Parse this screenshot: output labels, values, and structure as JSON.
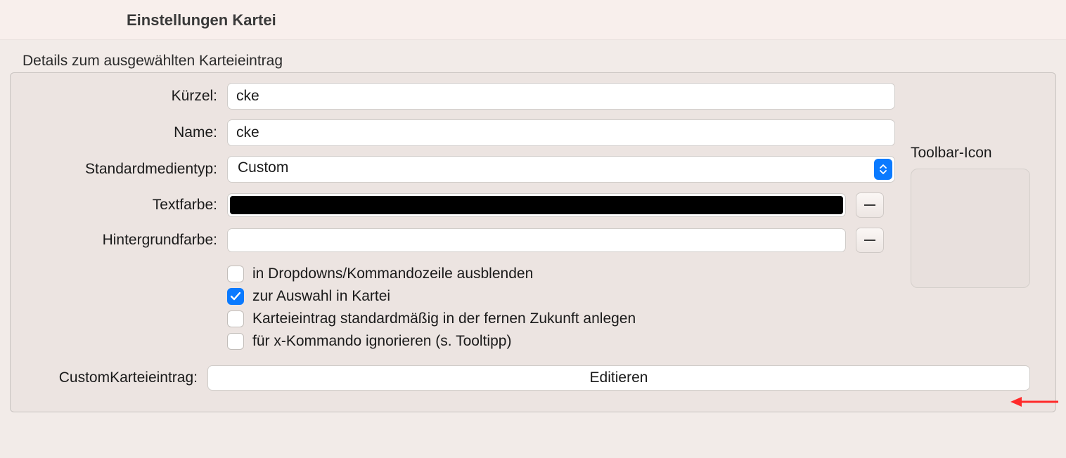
{
  "header": {
    "title": "Einstellungen Kartei"
  },
  "panel": {
    "legend": "Details zum ausgewählten Karteieintrag",
    "fields": {
      "kuerzel": {
        "label": "Kürzel:",
        "value": "cke"
      },
      "name": {
        "label": "Name:",
        "value": "cke"
      },
      "medientyp": {
        "label": "Standardmedientyp:",
        "selected": "Custom"
      },
      "textfarbe": {
        "label": "Textfarbe:",
        "color": "#000000"
      },
      "hintergrundfarbe": {
        "label": "Hintergrundfarbe:",
        "color": ""
      },
      "custom": {
        "label": "CustomKarteieintrag:",
        "button": "Editieren"
      }
    },
    "checkboxes": [
      {
        "label": "in Dropdowns/Kommandozeile ausblenden",
        "checked": false
      },
      {
        "label": "zur Auswahl in Kartei",
        "checked": true
      },
      {
        "label": "Karteieintrag standardmäßig in der fernen Zukunft anlegen",
        "checked": false
      },
      {
        "label": "für x-Kommando ignorieren (s. Tooltipp)",
        "checked": false
      }
    ],
    "toolbar_icon_label": "Toolbar-Icon"
  }
}
